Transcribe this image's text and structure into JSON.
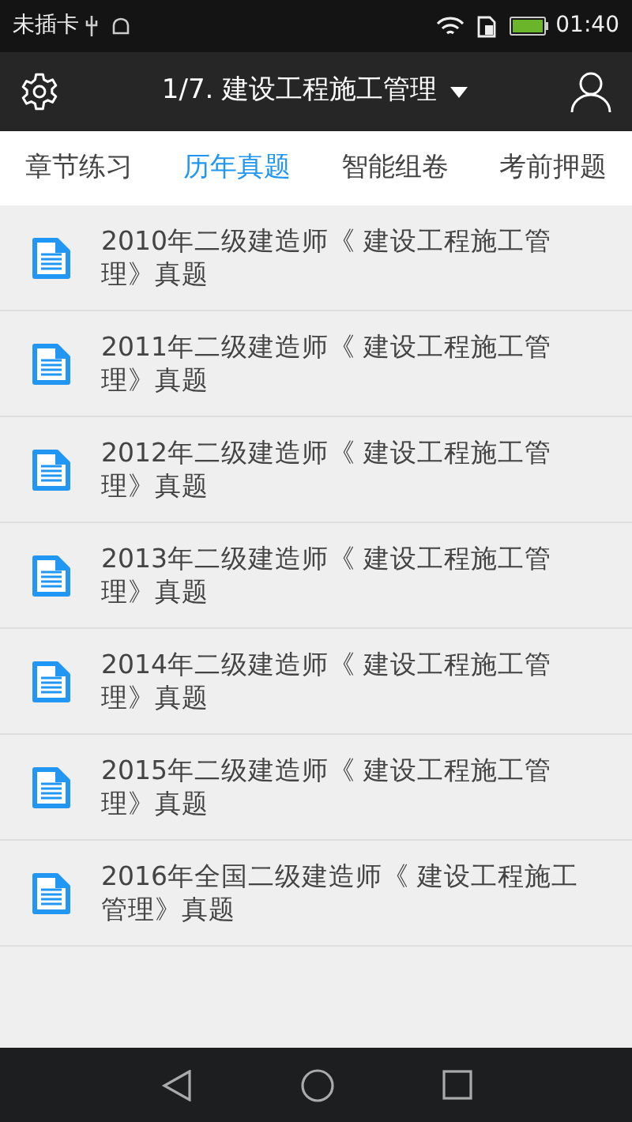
{
  "status_bar": {
    "carrier": "未插卡",
    "time": "01:40"
  },
  "app_bar": {
    "title": "1/7. 建设工程施工管理"
  },
  "tabs": [
    {
      "label": "章节练习",
      "selected": false
    },
    {
      "label": "历年真题",
      "selected": true
    },
    {
      "label": "智能组卷",
      "selected": false
    },
    {
      "label": "考前押题",
      "selected": false
    }
  ],
  "papers": [
    {
      "title": "2010年二级建造师《 建设工程施工管理》真题"
    },
    {
      "title": "2011年二级建造师《 建设工程施工管理》真题"
    },
    {
      "title": "2012年二级建造师《 建设工程施工管理》真题"
    },
    {
      "title": "2013年二级建造师《 建设工程施工管理》真题"
    },
    {
      "title": "2014年二级建造师《 建设工程施工管理》真题"
    },
    {
      "title": "2015年二级建造师《 建设工程施工管理》真题"
    },
    {
      "title": "2016年全国二级建造师《 建设工程施工管理》真题"
    }
  ]
}
